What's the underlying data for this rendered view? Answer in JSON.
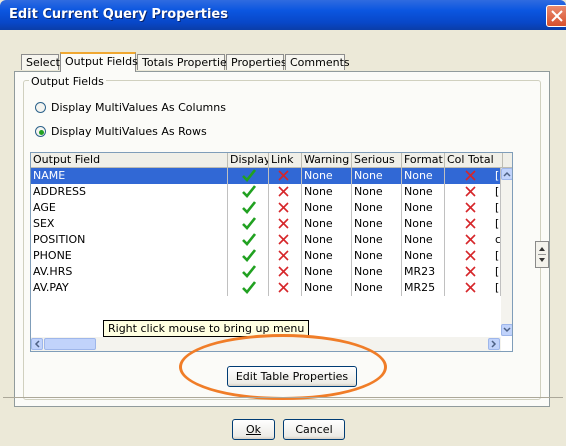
{
  "window": {
    "title": "Edit Current Query Properties"
  },
  "tabs": [
    {
      "label": "Select",
      "active": false
    },
    {
      "label": "Output Fields",
      "active": true
    },
    {
      "label": "Totals Properties",
      "active": false
    },
    {
      "label": "Properties",
      "active": false
    },
    {
      "label": "Comments",
      "active": false
    }
  ],
  "group": {
    "label": "Output Fields"
  },
  "radios": [
    {
      "label": "Display MultiValues As Columns",
      "checked": false
    },
    {
      "label": "Display MultiValues As Rows",
      "checked": true
    }
  ],
  "table": {
    "columns": [
      "Output Field",
      "Display",
      "Link",
      "Warning",
      "Serious",
      "Format",
      "Col Total"
    ],
    "rows": [
      {
        "field": "NAME",
        "warning": "None",
        "serious": "None",
        "format": "None",
        "extra": "["
      },
      {
        "field": "ADDRESS",
        "warning": "None",
        "serious": "None",
        "format": "None",
        "extra": "["
      },
      {
        "field": "AGE",
        "warning": "None",
        "serious": "None",
        "format": "None",
        "extra": "["
      },
      {
        "field": "SEX",
        "warning": "None",
        "serious": "None",
        "format": "None",
        "extra": "["
      },
      {
        "field": "POSITION",
        "warning": "None",
        "serious": "None",
        "format": "None",
        "extra": "c"
      },
      {
        "field": "PHONE",
        "warning": "None",
        "serious": "None",
        "format": "None",
        "extra": "["
      },
      {
        "field": "AV.HRS",
        "warning": "None",
        "serious": "None",
        "format": "MR23",
        "extra": "["
      },
      {
        "field": "AV.PAY",
        "warning": "None",
        "serious": "None",
        "format": "MR25",
        "extra": "["
      }
    ],
    "selected_row": 0
  },
  "tooltip": "Right click mouse to bring up menu",
  "buttons": {
    "edit_table": "Edit Table Properties",
    "ok": "Ok",
    "cancel": "Cancel"
  },
  "colors": {
    "check": "#21a121",
    "cross": "#d6262a",
    "highlight": "#f07d28",
    "selection": "#3168d5"
  },
  "icons": {
    "display": "check-icon",
    "link": "cross-icon",
    "col_total": "cross-icon"
  }
}
